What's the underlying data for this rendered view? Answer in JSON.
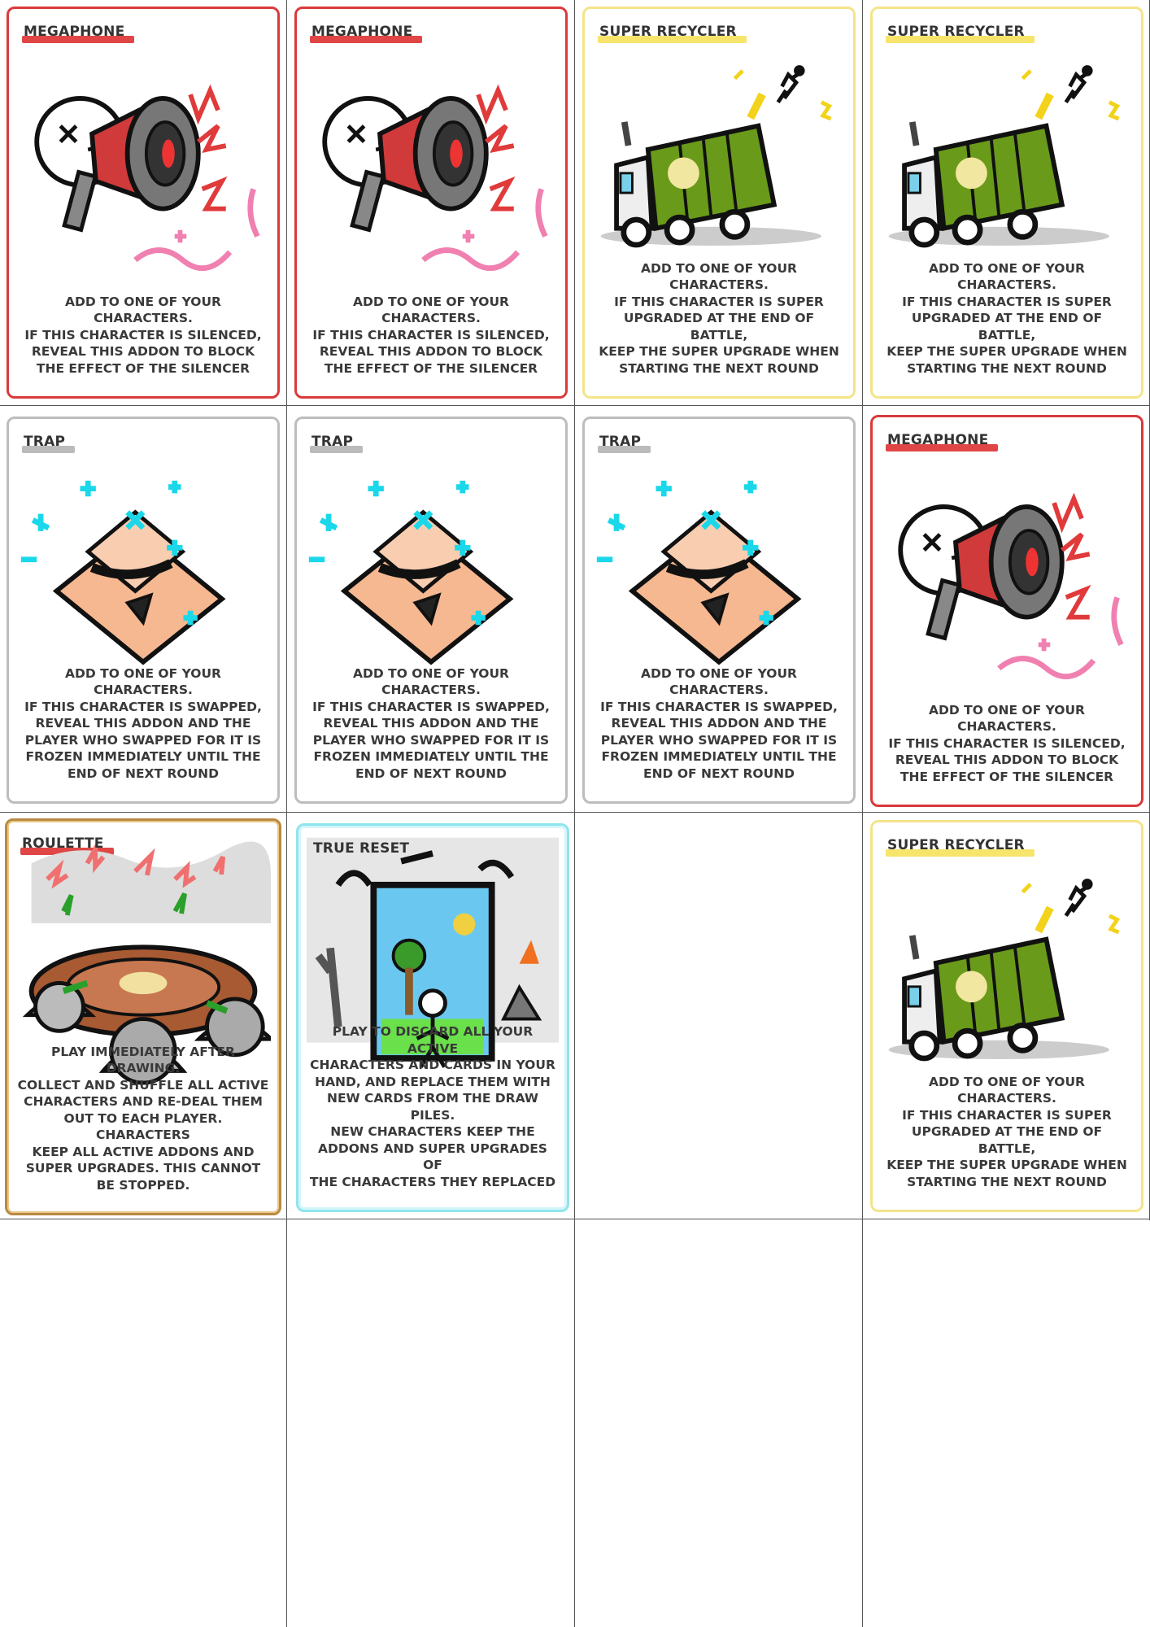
{
  "colors": {
    "megaphone_border": "#d93a3a",
    "recycler_border": "#f4e48a",
    "trap_border": "#bdbdbd",
    "roulette_border": "#b98a43",
    "reset_border": "#8fe4ee"
  },
  "cards": [
    {
      "title": "MEGAPHONE",
      "desc": "ADD TO ONE OF YOUR CHARACTERS.\nIF THIS CHARACTER IS SILENCED,\nREVEAL THIS ADDON TO BLOCK\nTHE EFFECT OF THE SILENCER",
      "icon": "megaphone-icon"
    },
    {
      "title": "MEGAPHONE",
      "desc": "ADD TO ONE OF YOUR CHARACTERS.\nIF THIS CHARACTER IS SILENCED,\nREVEAL THIS ADDON TO BLOCK\nTHE EFFECT OF THE SILENCER",
      "icon": "megaphone-icon"
    },
    {
      "title": "SUPER RECYCLER",
      "desc": "ADD TO ONE OF YOUR CHARACTERS.\nIF THIS CHARACTER IS SUPER\nUPGRADED AT THE END OF BATTLE,\nKEEP THE SUPER UPGRADE WHEN\nSTARTING THE NEXT ROUND",
      "icon": "garbage-truck-icon"
    },
    {
      "title": "SUPER RECYCLER",
      "desc": "ADD TO ONE OF YOUR CHARACTERS.\nIF THIS CHARACTER IS SUPER\nUPGRADED AT THE END OF BATTLE,\nKEEP THE SUPER UPGRADE WHEN\nSTARTING THE NEXT ROUND",
      "icon": "garbage-truck-icon"
    },
    {
      "title": "TRAP",
      "desc": "ADD TO ONE OF YOUR CHARACTERS.\nIF THIS CHARACTER IS SWAPPED,\nREVEAL THIS ADDON AND THE\nPLAYER WHO SWAPPED FOR IT IS\nFROZEN IMMEDIATELY UNTIL THE\nEND OF NEXT ROUND",
      "icon": "mousetrap-icon"
    },
    {
      "title": "TRAP",
      "desc": "ADD TO ONE OF YOUR CHARACTERS.\nIF THIS CHARACTER IS SWAPPED,\nREVEAL THIS ADDON AND THE\nPLAYER WHO SWAPPED FOR IT IS\nFROZEN IMMEDIATELY UNTIL THE\nEND OF NEXT ROUND",
      "icon": "mousetrap-icon"
    },
    {
      "title": "TRAP",
      "desc": "ADD TO ONE OF YOUR CHARACTERS.\nIF THIS CHARACTER IS SWAPPED,\nREVEAL THIS ADDON AND THE\nPLAYER WHO SWAPPED FOR IT IS\nFROZEN IMMEDIATELY UNTIL THE\nEND OF NEXT ROUND",
      "icon": "mousetrap-icon"
    },
    {
      "title": "MEGAPHONE",
      "desc": "ADD TO ONE OF YOUR CHARACTERS.\nIF THIS CHARACTER IS SILENCED,\nREVEAL THIS ADDON TO BLOCK\nTHE EFFECT OF THE SILENCER",
      "icon": "megaphone-icon"
    },
    {
      "title": "ROULETTE",
      "desc": "PLAY IMMEDIATELY AFTER DRAWING.\nCOLLECT AND SHUFFLE ALL ACTIVE\nCHARACTERS AND RE-DEAL THEM\nOUT TO EACH PLAYER. CHARACTERS\nKEEP ALL ACTIVE ADDONS AND\nSUPER UPGRADES. THIS CANNOT\nBE STOPPED.",
      "icon": "roulette-wheel-icon"
    },
    {
      "title": "TRUE RESET",
      "desc": "PLAY TO DISCARD ALL YOUR ACTIVE\nCHARACTERS AND CARDS IN YOUR\nHAND, AND REPLACE THEM WITH\nNEW CARDS FROM THE DRAW PILES.\nNEW CHARACTERS KEEP THE\nADDONS AND SUPER UPGRADES OF\nTHE CHARACTERS THEY REPLACED",
      "icon": "portal-door-icon"
    },
    {
      "title": "SUPER RECYCLER",
      "desc": "ADD TO ONE OF YOUR CHARACTERS.\nIF THIS CHARACTER IS SUPER\nUPGRADED AT THE END OF BATTLE,\nKEEP THE SUPER UPGRADE WHEN\nSTARTING THE NEXT ROUND",
      "icon": "garbage-truck-icon"
    }
  ]
}
